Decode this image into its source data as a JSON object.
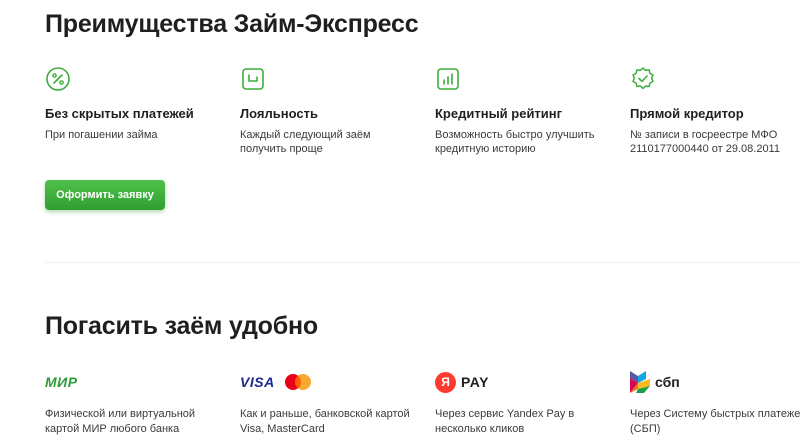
{
  "advantages": {
    "title": "Преимущества Займ-Экспресс",
    "items": [
      {
        "icon": "percent-icon",
        "title": "Без скрытых платежей",
        "desc": "При погашении займа"
      },
      {
        "icon": "wallet-icon",
        "title": "Лояльность",
        "desc": "Каждый следующий заём получить проще"
      },
      {
        "icon": "chart-icon",
        "title": "Кредитный рейтинг",
        "desc": "Возможность быстро улучшить кредитную историю"
      },
      {
        "icon": "verified-badge-icon",
        "title": "Прямой кредитор",
        "desc": "№ записи в госреестре МФО 2110177000440 от 29.08.2011"
      }
    ],
    "apply_button": "Оформить заявку"
  },
  "repay": {
    "title": "Погасить заём удобно",
    "items": [
      {
        "logo": "mir-logo",
        "logo_text": "МИР",
        "desc": "Физической или виртуальной картой МИР любого банка"
      },
      {
        "logo": "visa-mastercard-logo",
        "logo_text": "VISA",
        "desc": "Как и раньше, банковской картой Visa, MasterCard"
      },
      {
        "logo": "yandex-pay-logo",
        "logo_mark": "Я",
        "logo_text": "PAY",
        "desc": "Через сервис Yandex Pay в несколько кликов"
      },
      {
        "logo": "sbp-logo",
        "logo_text": "сбп",
        "desc": "Через Систему быстрых платежей (СБП)"
      }
    ]
  },
  "colors": {
    "accent_green": "#3cae3a",
    "text": "#1f1f1f",
    "mir_green": "#2e9b3a",
    "visa_blue": "#1a2a8f",
    "yandex_red": "#ff3b30"
  }
}
